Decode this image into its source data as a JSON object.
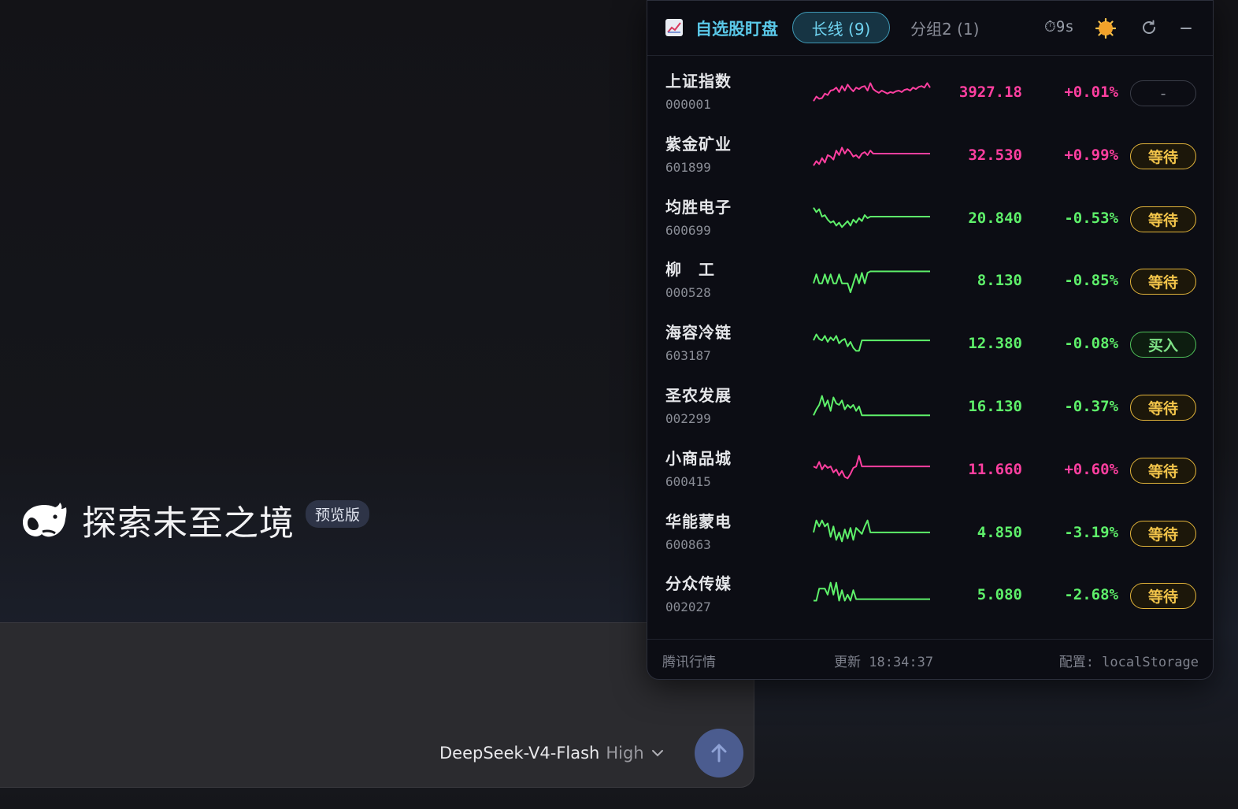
{
  "hero": {
    "title": "探索未至之境",
    "badge": "预览版"
  },
  "composer": {
    "model_name": "DeepSeek-V4-Flash",
    "model_level": "High"
  },
  "widget": {
    "title": "自选股盯盘",
    "tab_active": "长线 (9)",
    "tab_inactive": "分组2 (1)",
    "timer": "⏱9s",
    "footer": {
      "source": "腾讯行情",
      "updated": "更新 18:34:37",
      "config": "配置: localStorage"
    },
    "colors": {
      "up": "#ff3fa0",
      "down": "#5ef06a",
      "wait": "#f2c44a",
      "buy": "#7fe287",
      "accent": "#5ac8e8"
    },
    "stocks": [
      {
        "name": "上证指数",
        "code": "000001",
        "price": "3927.18",
        "change": "+0.01%",
        "action": "-",
        "dir": "up",
        "action_type": "neutral",
        "spark": [
          6,
          12,
          9,
          10,
          16,
          14,
          20,
          21,
          24,
          18,
          26,
          20,
          28,
          23,
          19,
          24,
          22,
          25,
          26,
          20,
          30,
          22,
          19,
          17,
          20,
          18,
          16,
          18,
          17,
          19,
          20,
          18,
          21,
          22,
          20,
          24,
          22,
          25,
          26,
          24,
          30,
          24
        ]
      },
      {
        "name": "紫金矿业",
        "code": "601899",
        "price": "32.530",
        "change": "+0.99%",
        "action": "等待",
        "dir": "up",
        "action_type": "wait",
        "spark": [
          4,
          10,
          6,
          14,
          8,
          18,
          16,
          12,
          24,
          18,
          28,
          20,
          26,
          22,
          16,
          18,
          14,
          20,
          22,
          18,
          24,
          20,
          20,
          20,
          20,
          20,
          20,
          20,
          20,
          20,
          20,
          20,
          20,
          20,
          20,
          20,
          20,
          20,
          20,
          20,
          20,
          20
        ]
      },
      {
        "name": "均胜电子",
        "code": "600699",
        "price": "20.840",
        "change": "-0.53%",
        "action": "等待",
        "dir": "down",
        "action_type": "wait",
        "spark": [
          32,
          26,
          30,
          20,
          22,
          16,
          12,
          14,
          8,
          12,
          6,
          10,
          14,
          8,
          16,
          12,
          18,
          14,
          22,
          18,
          20,
          20,
          20,
          20,
          20,
          20,
          20,
          20,
          20,
          20,
          20,
          20,
          20,
          20,
          20,
          20,
          20,
          20,
          20,
          20,
          20,
          20
        ]
      },
      {
        "name": "柳　工",
        "code": "000528",
        "price": "8.130",
        "change": "-0.85%",
        "action": "等待",
        "dir": "down",
        "action_type": "wait",
        "spark": [
          14,
          26,
          14,
          14,
          26,
          14,
          26,
          14,
          14,
          26,
          14,
          14,
          14,
          2,
          14,
          26,
          14,
          28,
          14,
          28,
          30,
          30,
          30,
          30,
          30,
          30,
          30,
          30,
          30,
          30,
          30,
          30,
          30,
          30,
          30,
          30,
          30,
          30,
          30,
          30,
          30,
          30
        ]
      },
      {
        "name": "海容冷链",
        "code": "603187",
        "price": "12.380",
        "change": "-0.08%",
        "action": "买入",
        "dir": "down",
        "action_type": "buy",
        "spark": [
          22,
          30,
          24,
          22,
          28,
          20,
          26,
          22,
          28,
          18,
          22,
          24,
          14,
          20,
          12,
          8,
          8,
          22,
          22,
          22,
          22,
          22,
          22,
          22,
          22,
          22,
          22,
          22,
          22,
          22,
          22,
          22,
          22,
          22,
          22,
          22,
          22,
          22,
          22,
          22,
          22,
          22
        ]
      },
      {
        "name": "圣农发展",
        "code": "002299",
        "price": "16.130",
        "change": "-0.37%",
        "action": "等待",
        "dir": "down",
        "action_type": "wait",
        "spark": [
          6,
          14,
          20,
          32,
          18,
          26,
          12,
          30,
          22,
          20,
          26,
          14,
          20,
          16,
          20,
          12,
          18,
          6,
          6,
          6,
          6,
          6,
          6,
          6,
          6,
          6,
          6,
          6,
          6,
          6,
          6,
          6,
          6,
          6,
          6,
          6,
          6,
          6,
          6,
          6,
          6,
          6
        ]
      },
      {
        "name": "小商品城",
        "code": "600415",
        "price": "11.660",
        "change": "+0.60%",
        "action": "等待",
        "dir": "up",
        "action_type": "up",
        "spark": [
          22,
          20,
          28,
          18,
          24,
          20,
          22,
          14,
          18,
          10,
          16,
          8,
          6,
          12,
          20,
          22,
          36,
          22,
          22,
          22,
          22,
          22,
          22,
          22,
          22,
          22,
          22,
          22,
          22,
          22,
          22,
          22,
          22,
          22,
          22,
          22,
          22,
          22,
          22,
          22,
          22,
          22
        ]
      },
      {
        "name": "华能蒙电",
        "code": "600863",
        "price": "4.850",
        "change": "-3.19%",
        "action": "等待",
        "dir": "down",
        "action_type": "wait",
        "spark": [
          18,
          34,
          26,
          34,
          26,
          30,
          12,
          26,
          8,
          18,
          6,
          22,
          10,
          24,
          8,
          24,
          20,
          16,
          26,
          34,
          18,
          18,
          18,
          18,
          18,
          18,
          18,
          18,
          18,
          18,
          18,
          18,
          18,
          18,
          18,
          18,
          18,
          18,
          18,
          18,
          18,
          18
        ]
      },
      {
        "name": "分众传媒",
        "code": "002027",
        "price": "5.080",
        "change": "-2.68%",
        "action": "等待",
        "dir": "down",
        "action_type": "wait",
        "spark": [
          10,
          10,
          26,
          26,
          26,
          18,
          34,
          18,
          34,
          10,
          24,
          10,
          18,
          10,
          24,
          12,
          12,
          12,
          12,
          12,
          12,
          12,
          12,
          12,
          12,
          12,
          12,
          12,
          12,
          12,
          12,
          12,
          12,
          12,
          12,
          12,
          12,
          12,
          12,
          12,
          12,
          12
        ]
      }
    ]
  }
}
